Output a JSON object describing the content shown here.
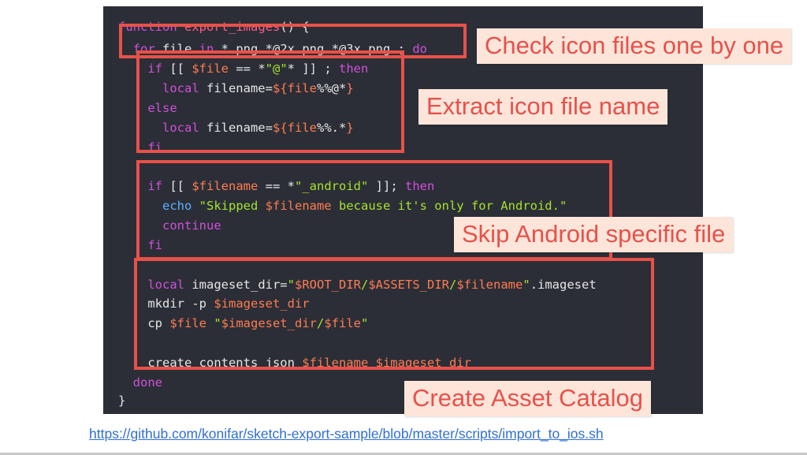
{
  "code": {
    "lines": [
      [
        {
          "t": "function ",
          "c": "kw"
        },
        {
          "t": "export_images",
          "c": "fn"
        },
        {
          "t": "() {",
          "c": "pl"
        }
      ],
      [
        {
          "t": "  for ",
          "c": "kw"
        },
        {
          "t": "file ",
          "c": "pl"
        },
        {
          "t": "in ",
          "c": "kw"
        },
        {
          "t": "*.png *@2x.png *@3x.png ; ",
          "c": "pl"
        },
        {
          "t": "do",
          "c": "kw"
        }
      ],
      [
        {
          "t": "    if ",
          "c": "kw"
        },
        {
          "t": "[[ ",
          "c": "pl"
        },
        {
          "t": "$file",
          "c": "var"
        },
        {
          "t": " == *",
          "c": "pl"
        },
        {
          "t": "\"@\"",
          "c": "str"
        },
        {
          "t": "* ]] ; ",
          "c": "pl"
        },
        {
          "t": "then",
          "c": "kw"
        }
      ],
      [
        {
          "t": "      local ",
          "c": "kw"
        },
        {
          "t": "filename=",
          "c": "pl"
        },
        {
          "t": "${file",
          "c": "var"
        },
        {
          "t": "%%@*",
          "c": "pl"
        },
        {
          "t": "}",
          "c": "var"
        }
      ],
      [
        {
          "t": "    else",
          "c": "kw"
        }
      ],
      [
        {
          "t": "      local ",
          "c": "kw"
        },
        {
          "t": "filename=",
          "c": "pl"
        },
        {
          "t": "${file",
          "c": "var"
        },
        {
          "t": "%%.*",
          "c": "pl"
        },
        {
          "t": "}",
          "c": "var"
        }
      ],
      [
        {
          "t": "    fi",
          "c": "kw"
        }
      ],
      [],
      [
        {
          "t": "    if ",
          "c": "kw"
        },
        {
          "t": "[[ ",
          "c": "pl"
        },
        {
          "t": "$filename",
          "c": "var"
        },
        {
          "t": " == *",
          "c": "pl"
        },
        {
          "t": "\"_android\"",
          "c": "str"
        },
        {
          "t": " ]]; ",
          "c": "pl"
        },
        {
          "t": "then",
          "c": "kw"
        }
      ],
      [
        {
          "t": "      echo ",
          "c": "blue"
        },
        {
          "t": "\"Skipped ",
          "c": "str"
        },
        {
          "t": "$filename",
          "c": "var"
        },
        {
          "t": " because it's only for Android.\"",
          "c": "str"
        }
      ],
      [
        {
          "t": "      continue",
          "c": "kw"
        }
      ],
      [
        {
          "t": "    fi",
          "c": "kw"
        }
      ],
      [],
      [
        {
          "t": "    local ",
          "c": "kw"
        },
        {
          "t": "imageset_dir=",
          "c": "pl"
        },
        {
          "t": "\"",
          "c": "str"
        },
        {
          "t": "$ROOT_DIR",
          "c": "var"
        },
        {
          "t": "/",
          "c": "str"
        },
        {
          "t": "$ASSETS_DIR",
          "c": "var"
        },
        {
          "t": "/",
          "c": "str"
        },
        {
          "t": "$filename",
          "c": "var"
        },
        {
          "t": "\"",
          "c": "str"
        },
        {
          "t": ".imageset",
          "c": "pl"
        }
      ],
      [
        {
          "t": "    mkdir -p ",
          "c": "pl"
        },
        {
          "t": "$imageset_dir",
          "c": "var"
        }
      ],
      [
        {
          "t": "    cp ",
          "c": "pl"
        },
        {
          "t": "$file ",
          "c": "var"
        },
        {
          "t": "\"",
          "c": "str"
        },
        {
          "t": "$imageset_dir",
          "c": "var"
        },
        {
          "t": "/",
          "c": "str"
        },
        {
          "t": "$file",
          "c": "var"
        },
        {
          "t": "\"",
          "c": "str"
        }
      ],
      [],
      [
        {
          "t": "    create_contents_json ",
          "c": "pl"
        },
        {
          "t": "$filename ",
          "c": "var"
        },
        {
          "t": "$imageset_dir",
          "c": "var"
        }
      ],
      [
        {
          "t": "  done",
          "c": "kw"
        }
      ],
      [
        {
          "t": "}",
          "c": "pl"
        }
      ]
    ]
  },
  "callouts": {
    "check": "Check icon files one by one",
    "extract": "Extract icon file name",
    "skip": "Skip Android specific file",
    "create": "Create Asset Catalog"
  },
  "source_url": "https://github.com/konifar/sketch-export-sample/blob/master/scripts/import_to_ios.sh",
  "colors": {
    "panel_bg": "#2b2e36",
    "highlight": "#e8514a",
    "callout_bg": "#fde5da",
    "keyword": "#d24fdc",
    "function_name": "#ff5c8a",
    "variable": "#ff7b52",
    "string": "#a6e22e",
    "builtin": "#5ab1ff",
    "link": "#2f6fd6"
  }
}
